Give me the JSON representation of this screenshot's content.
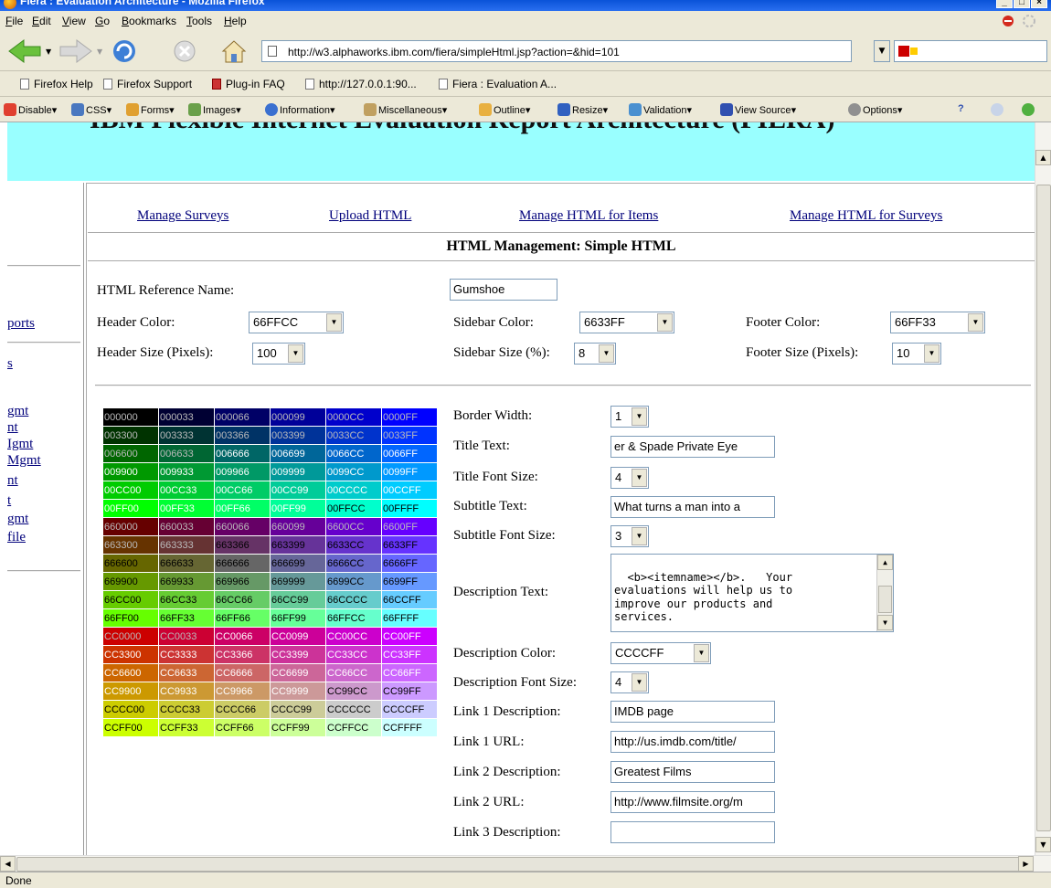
{
  "window": {
    "title": "Fiera : Evaluation Architecture - Mozilla Firefox"
  },
  "menu": [
    "File",
    "Edit",
    "View",
    "Go",
    "Bookmarks",
    "Tools",
    "Help"
  ],
  "url": "http://w3.alphaworks.ibm.com/fiera/simpleHtml.jsp?action=&hid=101",
  "bookmarks": [
    "Firefox Help",
    "Firefox Support",
    "Plug-in FAQ",
    "http://127.0.0.1:90...",
    "Fiera : Evaluation A..."
  ],
  "devtoolbar": [
    "Disable",
    "CSS",
    "Forms",
    "Images",
    "Information",
    "Miscellaneous",
    "Outline",
    "Resize",
    "Validation",
    "View Source",
    "Options"
  ],
  "page": {
    "header_title": "IBM Flexible Internet Evaluation Report Architecture (FIERA)",
    "left_links": [
      "ports",
      "s",
      "gmt",
      "nt",
      "Igmt",
      "Mgmt",
      "nt",
      "t",
      "gmt",
      "file"
    ],
    "nav_links": [
      "Manage Surveys",
      "Upload HTML",
      "Manage HTML for Items",
      "Manage HTML for Surveys"
    ],
    "section_title": "HTML Management: Simple HTML",
    "form": {
      "ref_name_label": "HTML Reference Name:",
      "ref_name_value": "Gumshoe",
      "header_color_label": "Header Color:",
      "header_color_value": "66FFCC",
      "sidebar_color_label": "Sidebar Color:",
      "sidebar_color_value": "6633FF",
      "footer_color_label": "Footer Color:",
      "footer_color_value": "66FF33",
      "header_size_label": "Header Size (Pixels):",
      "header_size_value": "100",
      "sidebar_size_label": "Sidebar Size (%):",
      "sidebar_size_value": "8",
      "footer_size_label": "Footer Size (Pixels):",
      "footer_size_value": "10",
      "border_width_label": "Border Width:",
      "border_width_value": "1",
      "title_text_label": "Title Text:",
      "title_text_value": "er & Spade Private Eye",
      "title_font_size_label": "Title Font Size:",
      "title_font_size_value": "4",
      "subtitle_text_label": "Subtitle Text:",
      "subtitle_text_value": "What turns a man into a",
      "subtitle_font_size_label": "Subtitle Font Size:",
      "subtitle_font_size_value": "3",
      "description_text_label": "Description Text:",
      "description_text_value": "<b><itemname></b>.   Your\nevaluations will help us to\nimprove our products and\nservices.",
      "description_color_label": "Description Color:",
      "description_color_value": "CCCCFF",
      "description_font_size_label": "Description Font Size:",
      "description_font_size_value": "4",
      "link1_desc_label": "Link 1 Description:",
      "link1_desc_value": "IMDB page",
      "link1_url_label": "Link 1 URL:",
      "link1_url_value": "http://us.imdb.com/title/",
      "link2_desc_label": "Link 2 Description:",
      "link2_desc_value": "Greatest Films",
      "link2_url_label": "Link 2 URL:",
      "link2_url_value": "http://www.filmsite.org/m",
      "link3_desc_label": "Link 3 Description:",
      "link3_desc_value": ""
    },
    "palette": [
      [
        "000000",
        "000033",
        "000066",
        "000099",
        "0000CC",
        "0000FF"
      ],
      [
        "003300",
        "003333",
        "003366",
        "003399",
        "0033CC",
        "0033FF"
      ],
      [
        "006600",
        "006633",
        "006666",
        "006699",
        "0066CC",
        "0066FF"
      ],
      [
        "009900",
        "009933",
        "009966",
        "009999",
        "0099CC",
        "0099FF"
      ],
      [
        "00CC00",
        "00CC33",
        "00CC66",
        "00CC99",
        "00CCCC",
        "00CCFF"
      ],
      [
        "00FF00",
        "00FF33",
        "00FF66",
        "00FF99",
        "00FFCC",
        "00FFFF"
      ],
      [
        "660000",
        "660033",
        "660066",
        "660099",
        "6600CC",
        "6600FF"
      ],
      [
        "663300",
        "663333",
        "663366",
        "663399",
        "6633CC",
        "6633FF"
      ],
      [
        "666600",
        "666633",
        "666666",
        "666699",
        "6666CC",
        "6666FF"
      ],
      [
        "669900",
        "669933",
        "669966",
        "669999",
        "6699CC",
        "6699FF"
      ],
      [
        "66CC00",
        "66CC33",
        "66CC66",
        "66CC99",
        "66CCCC",
        "66CCFF"
      ],
      [
        "66FF00",
        "66FF33",
        "66FF66",
        "66FF99",
        "66FFCC",
        "66FFFF"
      ],
      [
        "CC0000",
        "CC0033",
        "CC0066",
        "CC0099",
        "CC00CC",
        "CC00FF"
      ],
      [
        "CC3300",
        "CC3333",
        "CC3366",
        "CC3399",
        "CC33CC",
        "CC33FF"
      ],
      [
        "CC6600",
        "CC6633",
        "CC6666",
        "CC6699",
        "CC66CC",
        "CC66FF"
      ],
      [
        "CC9900",
        "CC9933",
        "CC9966",
        "CC9999",
        "CC99CC",
        "CC99FF"
      ],
      [
        "CCCC00",
        "CCCC33",
        "CCCC66",
        "CCCC99",
        "CCCCCC",
        "CCCCFF"
      ],
      [
        "CCFF00",
        "CCFF33",
        "CCFF66",
        "CCFF99",
        "CCFFCC",
        "CCFFFF"
      ]
    ]
  },
  "status": "Done"
}
